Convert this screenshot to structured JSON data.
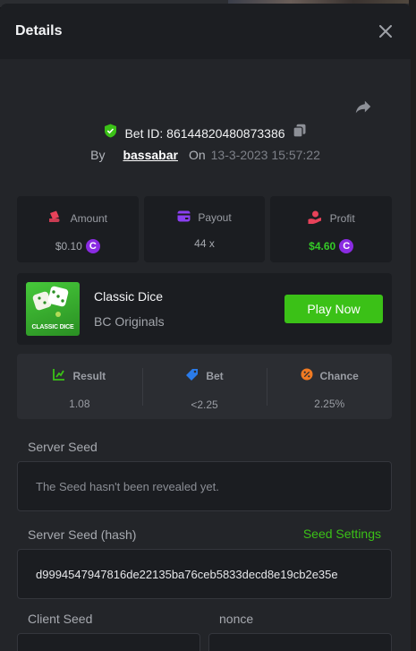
{
  "header": {
    "title": "Details"
  },
  "bet": {
    "id_label": "Bet ID: 86144820480873386",
    "by_label": "By",
    "username": "bassabar",
    "on_label": "On",
    "date": "13-3-2023 15:57:22"
  },
  "stats": {
    "amount": {
      "label": "Amount",
      "value": "$0.10",
      "coin": "C"
    },
    "payout": {
      "label": "Payout",
      "value": "44 x"
    },
    "profit": {
      "label": "Profit",
      "value": "$4.60",
      "coin": "C"
    }
  },
  "game": {
    "name": "Classic Dice",
    "provider": "BC Originals",
    "thumb_text": "CLASSIC DICE",
    "play_label": "Play Now"
  },
  "result": {
    "result": {
      "label": "Result",
      "value": "1.08"
    },
    "bet": {
      "label": "Bet",
      "value": "<2.25"
    },
    "chance": {
      "label": "Chance",
      "value": "2.25%"
    }
  },
  "seeds": {
    "server_seed_label": "Server Seed",
    "server_seed_value": "The Seed hasn't been revealed yet.",
    "server_hash_label": "Server Seed (hash)",
    "seed_settings_label": "Seed Settings",
    "server_hash_value": "d9994547947816de22135ba76ceb5833decd8e19cb2e35e",
    "client_seed_label": "Client Seed",
    "nonce_label": "nonce"
  },
  "colors": {
    "accent_green": "#3bc117",
    "profit_green": "#34c927",
    "coin_purple": "#8a2be2",
    "background": "#232529"
  }
}
